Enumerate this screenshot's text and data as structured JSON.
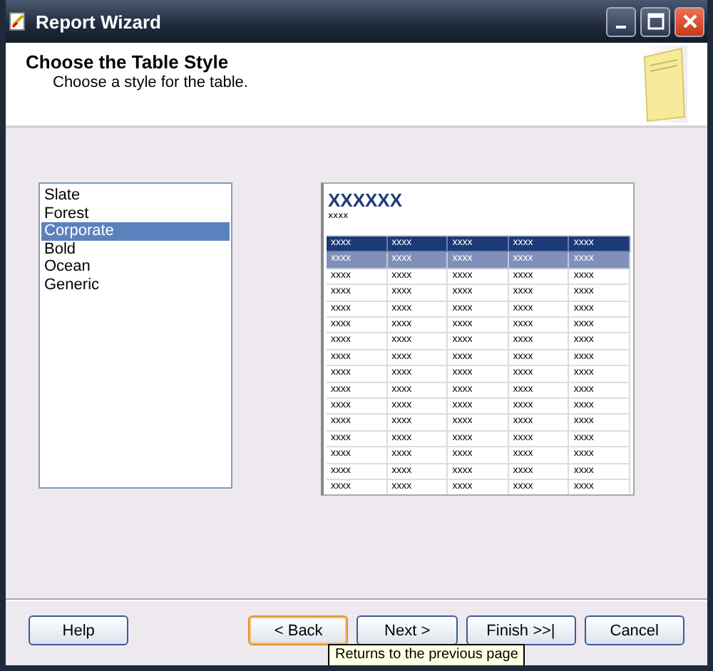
{
  "window": {
    "title": "Report Wizard"
  },
  "header": {
    "title": "Choose the Table Style",
    "subtitle": "Choose a style for the table."
  },
  "styles": [
    {
      "label": "Slate",
      "selected": false
    },
    {
      "label": "Forest",
      "selected": false
    },
    {
      "label": "Corporate",
      "selected": true
    },
    {
      "label": "Bold",
      "selected": false
    },
    {
      "label": "Ocean",
      "selected": false
    },
    {
      "label": "Generic",
      "selected": false
    }
  ],
  "preview": {
    "title": "XXXXXX",
    "subtitle": "xxxx",
    "header": [
      "xxxx",
      "xxxx",
      "xxxx",
      "xxxx",
      "xxxx"
    ],
    "rows": [
      [
        "xxxx",
        "xxxx",
        "xxxx",
        "xxxx",
        "xxxx"
      ],
      [
        "xxxx",
        "xxxx",
        "xxxx",
        "xxxx",
        "xxxx"
      ],
      [
        "xxxx",
        "xxxx",
        "xxxx",
        "xxxx",
        "xxxx"
      ],
      [
        "xxxx",
        "xxxx",
        "xxxx",
        "xxxx",
        "xxxx"
      ],
      [
        "xxxx",
        "xxxx",
        "xxxx",
        "xxxx",
        "xxxx"
      ],
      [
        "xxxx",
        "xxxx",
        "xxxx",
        "xxxx",
        "xxxx"
      ],
      [
        "xxxx",
        "xxxx",
        "xxxx",
        "xxxx",
        "xxxx"
      ],
      [
        "xxxx",
        "xxxx",
        "xxxx",
        "xxxx",
        "xxxx"
      ],
      [
        "xxxx",
        "xxxx",
        "xxxx",
        "xxxx",
        "xxxx"
      ],
      [
        "xxxx",
        "xxxx",
        "xxxx",
        "xxxx",
        "xxxx"
      ],
      [
        "xxxx",
        "xxxx",
        "xxxx",
        "xxxx",
        "xxxx"
      ],
      [
        "xxxx",
        "xxxx",
        "xxxx",
        "xxxx",
        "xxxx"
      ],
      [
        "xxxx",
        "xxxx",
        "xxxx",
        "xxxx",
        "xxxx"
      ],
      [
        "xxxx",
        "xxxx",
        "xxxx",
        "xxxx",
        "xxxx"
      ],
      [
        "xxxx",
        "xxxx",
        "xxxx",
        "xxxx",
        "xxxx"
      ]
    ]
  },
  "buttons": [
    {
      "label": "Help",
      "focused": false
    },
    {
      "label": "< Back",
      "focused": true
    },
    {
      "label": "Next >",
      "focused": false
    },
    {
      "label": "Finish >>|",
      "focused": false
    },
    {
      "label": "Cancel",
      "focused": false
    }
  ],
  "tooltip": "Returns to the previous page"
}
